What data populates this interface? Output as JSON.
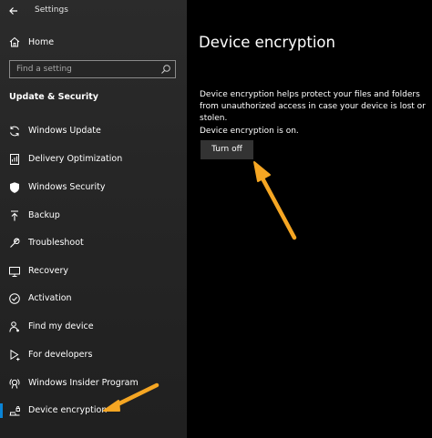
{
  "window": {
    "title": "Settings"
  },
  "sidebar": {
    "home_label": "Home",
    "search_placeholder": "Find a setting",
    "section_title": "Update & Security",
    "items": [
      {
        "label": "Windows Update",
        "icon": "refresh-icon"
      },
      {
        "label": "Delivery Optimization",
        "icon": "delivery-optimization-icon"
      },
      {
        "label": "Windows Security",
        "icon": "shield-icon"
      },
      {
        "label": "Backup",
        "icon": "backup-icon"
      },
      {
        "label": "Troubleshoot",
        "icon": "wrench-icon"
      },
      {
        "label": "Recovery",
        "icon": "recovery-icon"
      },
      {
        "label": "Activation",
        "icon": "check-circle-icon"
      },
      {
        "label": "Find my device",
        "icon": "person-locate-icon"
      },
      {
        "label": "For developers",
        "icon": "developer-icon"
      },
      {
        "label": "Windows Insider Program",
        "icon": "insider-icon"
      },
      {
        "label": "Device encryption",
        "icon": "device-encryption-icon",
        "selected": true
      }
    ]
  },
  "main": {
    "title": "Device encryption",
    "description": "Device encryption helps protect your files and folders from unauthorized access in case your device is lost or stolen.",
    "status": "Device encryption is on.",
    "turn_off_label": "Turn off"
  },
  "colors": {
    "sidebar_bg": "#2b2b2b",
    "main_bg": "#000000",
    "accent": "#0a84d6",
    "button_bg": "#333333",
    "annotation_arrow": "#f5a623"
  }
}
